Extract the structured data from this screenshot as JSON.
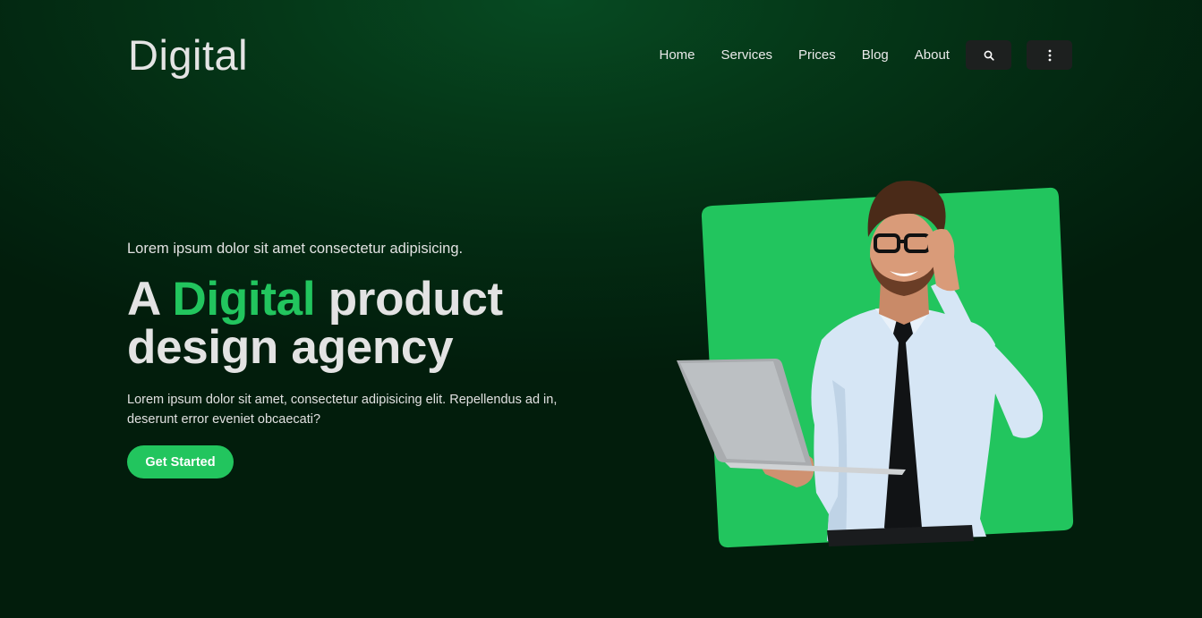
{
  "brand": {
    "logo_text": "Digital"
  },
  "nav": {
    "items": [
      {
        "label": "Home"
      },
      {
        "label": "Services"
      },
      {
        "label": "Prices"
      },
      {
        "label": "Blog"
      },
      {
        "label": "About"
      }
    ],
    "search_icon": "search-icon",
    "menu_icon": "more-vertical-icon"
  },
  "hero": {
    "kicker": "Lorem ipsum dolor sit amet consectetur adipisicing.",
    "headline_prefix": "A ",
    "headline_accent": "Digital",
    "headline_suffix": " product",
    "headline_line2": "design agency",
    "description": "Lorem ipsum dolor sit amet, consectetur adipisicing elit. Repellendus ad in, deserunt error eveniet obcaecati?",
    "cta_label": "Get Started"
  },
  "colors": {
    "accent": "#22c55e",
    "background": "#032a12",
    "nav_button_bg": "#1d201f"
  }
}
